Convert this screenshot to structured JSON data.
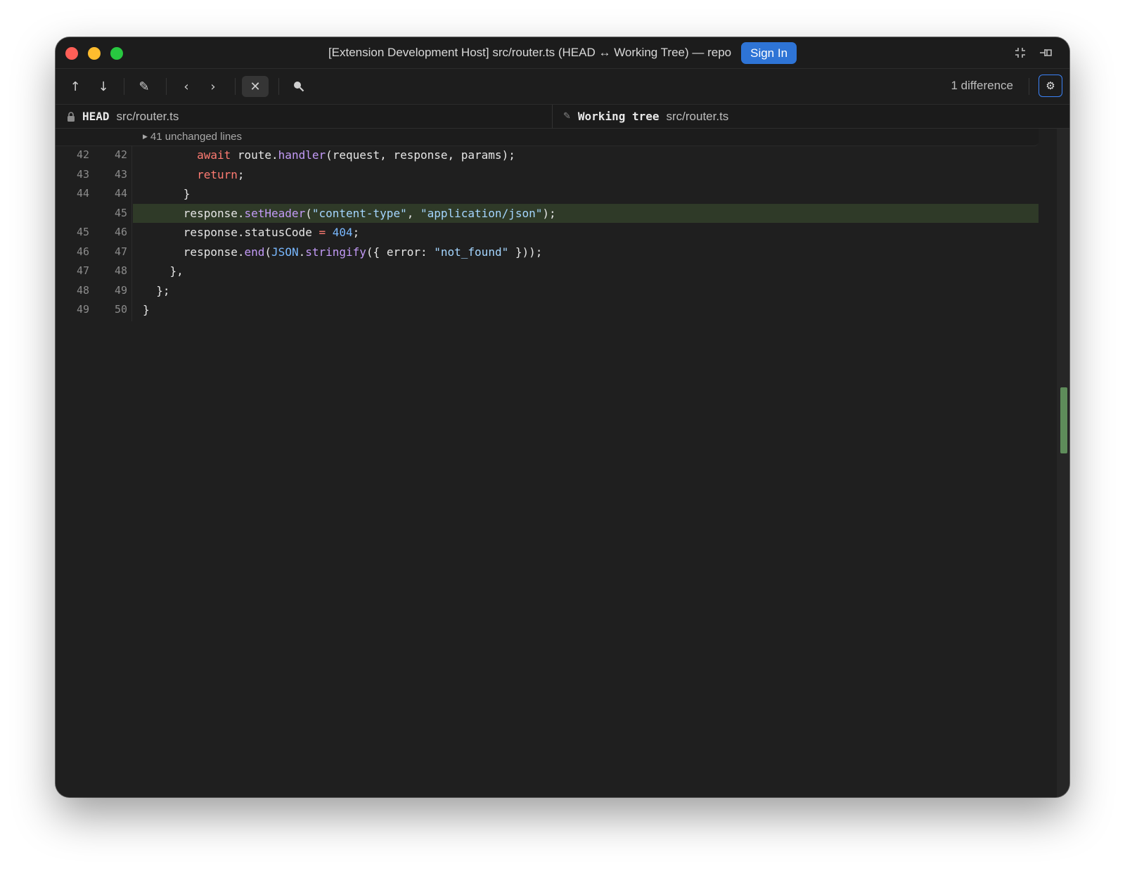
{
  "titlebar": {
    "title": "[Extension Development Host] src/router.ts (HEAD ↔ Working Tree) — repo",
    "sign_in_label": "Sign In",
    "icons": [
      "close-window",
      "minimize-window",
      "zoom-window",
      "collapse-icon",
      "pin-icon"
    ]
  },
  "toolbar": {
    "tools": [
      {
        "name": "previous-change-button",
        "icon": "arrow-up-icon",
        "glyph": "↑"
      },
      {
        "name": "next-change-button",
        "icon": "arrow-down-icon",
        "glyph": "↓"
      },
      {
        "name": "edit-button",
        "icon": "pencil-icon",
        "glyph": "✎"
      },
      {
        "name": "previous-file-button",
        "icon": "chevron-left-icon",
        "glyph": "‹"
      },
      {
        "name": "next-file-button",
        "icon": "chevron-right-icon",
        "glyph": "›"
      },
      {
        "name": "collapse-unchanged-button",
        "icon": "collapse-icon",
        "glyph": "✕"
      },
      {
        "name": "search-button",
        "icon": "search-icon",
        "glyph": "●"
      }
    ],
    "diff_count": "1 difference",
    "settings_icon": "gear-icon"
  },
  "left_pane": {
    "ref": "HEAD",
    "path": "src/router.ts",
    "icon": "lock-icon"
  },
  "right_pane": {
    "ref": "Working tree",
    "path": "src/router.ts",
    "icon": "pencil-icon"
  },
  "editor": {
    "unchanged_label": "41 unchanged lines",
    "lines": [
      {
        "old": "42",
        "new": "42",
        "type": "same",
        "segments": [
          {
            "t": "        ",
            "c": "#e6e6e6"
          },
          {
            "t": "await",
            "c": "#ff7b72"
          },
          {
            "t": " route.",
            "c": "#e6e6e6"
          },
          {
            "t": "handler",
            "c": "#c39bf7"
          },
          {
            "t": "(request, response, params);",
            "c": "#e6e6e6"
          }
        ]
      },
      {
        "old": "43",
        "new": "43",
        "type": "same",
        "segments": [
          {
            "t": "        ",
            "c": "#e6e6e6"
          },
          {
            "t": "return",
            "c": "#ff7b72"
          },
          {
            "t": ";",
            "c": "#e6e6e6"
          }
        ]
      },
      {
        "old": "44",
        "new": "44",
        "type": "same",
        "segments": [
          {
            "t": "      }",
            "c": "#e6e6e6"
          }
        ]
      },
      {
        "old": "",
        "new": "45",
        "type": "added",
        "segments": [
          {
            "t": "      response.",
            "c": "#e6e6e6"
          },
          {
            "t": "setHeader",
            "c": "#c39bf7"
          },
          {
            "t": "(",
            "c": "#e6e6e6"
          },
          {
            "t": "\"content-type\"",
            "c": "#a5d6ff"
          },
          {
            "t": ", ",
            "c": "#e6e6e6"
          },
          {
            "t": "\"application/json\"",
            "c": "#a5d6ff"
          },
          {
            "t": ");",
            "c": "#e6e6e6"
          }
        ]
      },
      {
        "old": "45",
        "new": "46",
        "type": "same",
        "segments": [
          {
            "t": "      response.statusCode ",
            "c": "#e6e6e6"
          },
          {
            "t": "=",
            "c": "#ff7b72"
          },
          {
            "t": " ",
            "c": "#e6e6e6"
          },
          {
            "t": "404",
            "c": "#79b8ff"
          },
          {
            "t": ";",
            "c": "#e6e6e6"
          }
        ]
      },
      {
        "old": "46",
        "new": "47",
        "type": "same",
        "segments": [
          {
            "t": "      response.",
            "c": "#e6e6e6"
          },
          {
            "t": "end",
            "c": "#c39bf7"
          },
          {
            "t": "(",
            "c": "#e6e6e6"
          },
          {
            "t": "JSON",
            "c": "#79b8ff"
          },
          {
            "t": ".",
            "c": "#e6e6e6"
          },
          {
            "t": "stringify",
            "c": "#c39bf7"
          },
          {
            "t": "({ error: ",
            "c": "#e6e6e6"
          },
          {
            "t": "\"not_found\"",
            "c": "#a5d6ff"
          },
          {
            "t": " }));",
            "c": "#e6e6e6"
          }
        ]
      },
      {
        "old": "47",
        "new": "48",
        "type": "same",
        "segments": [
          {
            "t": "    },",
            "c": "#e6e6e6"
          }
        ]
      },
      {
        "old": "48",
        "new": "49",
        "type": "same",
        "segments": [
          {
            "t": "  };",
            "c": "#e6e6e6"
          }
        ]
      },
      {
        "old": "49",
        "new": "50",
        "type": "same",
        "segments": [
          {
            "t": "}",
            "c": "#e6e6e6"
          }
        ]
      }
    ]
  },
  "colors": {
    "added_line_bg": "#2f3a28",
    "accent": "#2e74d6",
    "scroll_marker": "#5e8c5a"
  }
}
